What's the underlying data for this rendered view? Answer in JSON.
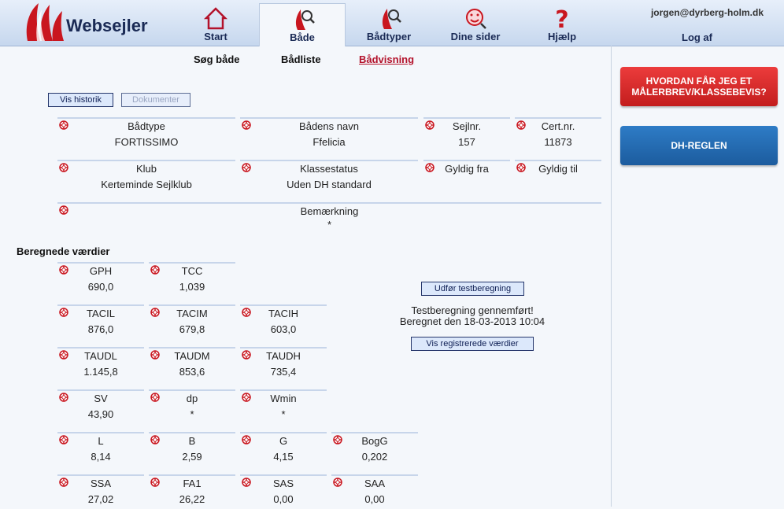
{
  "header": {
    "logo_text": "Websejler",
    "user_email": "jorgen@dyrberg-holm.dk",
    "logout_label": "Log af",
    "tabs": [
      {
        "label": "Start",
        "icon": "house-icon"
      },
      {
        "label": "Både",
        "icon": "boat-search-icon"
      },
      {
        "label": "Bådtyper",
        "icon": "boat-search-icon"
      },
      {
        "label": "Dine sider",
        "icon": "smiley-icon"
      },
      {
        "label": "Hjælp",
        "icon": "question-icon"
      }
    ]
  },
  "subnav": {
    "search": "Søg både",
    "list": "Bådliste",
    "view": "Bådvisning"
  },
  "actions": {
    "history": "Vis historik",
    "documents": "Dokumenter"
  },
  "boat_info": {
    "type_label": "Bådtype",
    "type_value": "FORTISSIMO",
    "name_label": "Bådens navn",
    "name_value": "Ffelicia",
    "sail_label": "Sejlnr.",
    "sail_value": "157",
    "cert_label": "Cert.nr.",
    "cert_value": "11873",
    "club_label": "Klub",
    "club_value": "Kerteminde Sejlklub",
    "class_label": "Klassestatus",
    "class_value": "Uden DH standard",
    "valid_from_label": "Gyldig fra",
    "valid_from_value": "",
    "valid_to_label": "Gyldig til",
    "valid_to_value": "",
    "remark_label": "Bemærkning",
    "remark_value": "*"
  },
  "calc": {
    "title": "Beregnede værdier",
    "rows": [
      [
        {
          "label": "GPH",
          "value": "690,0"
        },
        {
          "label": "TCC",
          "value": "1,039"
        }
      ],
      [
        {
          "label": "TACIL",
          "value": "876,0"
        },
        {
          "label": "TACIM",
          "value": "679,8"
        },
        {
          "label": "TACIH",
          "value": "603,0"
        }
      ],
      [
        {
          "label": "TAUDL",
          "value": "1.145,8"
        },
        {
          "label": "TAUDM",
          "value": "853,6"
        },
        {
          "label": "TAUDH",
          "value": "735,4"
        }
      ],
      [
        {
          "label": "SV",
          "value": "43,90"
        },
        {
          "label": "dp",
          "value": "*"
        },
        {
          "label": "Wmin",
          "value": "*"
        }
      ],
      [
        {
          "label": "L",
          "value": "8,14"
        },
        {
          "label": "B",
          "value": "2,59"
        },
        {
          "label": "G",
          "value": "4,15"
        },
        {
          "label": "BogG",
          "value": "0,202"
        }
      ],
      [
        {
          "label": "SSA",
          "value": "27,02"
        },
        {
          "label": "FA1",
          "value": "26,22"
        },
        {
          "label": "SAS",
          "value": "0,00"
        },
        {
          "label": "SAA",
          "value": "0,00"
        }
      ]
    ],
    "test_button": "Udfør testberegning",
    "status_line1": "Testberegning gennemført!",
    "status_line2": "Beregnet den 18-03-2013 10:04",
    "registered_button": "Vis registrerede værdier"
  },
  "side_buttons": {
    "certificate_line1": "HVORDAN FÅR JEG ET",
    "certificate_line2": "MÅLERBREV/KLASSEBEVIS?",
    "dh_rule": "DH-REGLEN"
  },
  "colors": {
    "brand_red": "#c31d1d",
    "brand_blue": "#1c5c9e",
    "link_current": "#b3122b"
  }
}
